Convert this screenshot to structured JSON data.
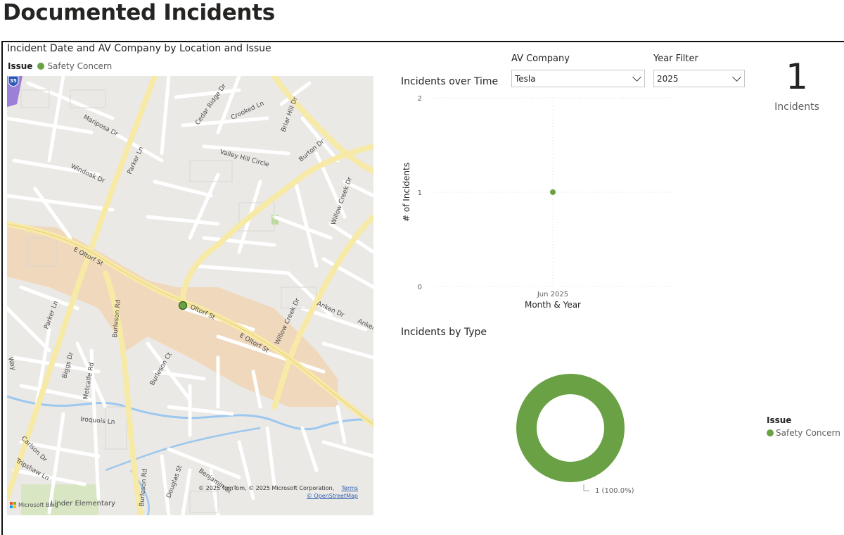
{
  "page": {
    "title": "Documented Incidents"
  },
  "map": {
    "title": "Incident Date and AV Company by Location and Issue",
    "legend_title": "Issue",
    "legend_item": "Safety Concern",
    "legend_color": "#6aa145",
    "highway_shield": "35",
    "streets": {
      "mariposa": "Mariposa Dr",
      "parker_ln_n": "Parker Ln",
      "cedar_ridge": "Cedar Ridge Dr",
      "crooked": "Crooked Ln",
      "briar_hill": "Briar Hill Dr",
      "valley_hill": "Valley Hill Circle",
      "windoak": "Windoak Dr",
      "burton": "Burton Dr",
      "willow_creek_n": "Willow Creek Dr",
      "e_oltorf_w": "E Oltorf St",
      "oltorf_mid": "Oltorf St",
      "e_oltorf_e": "E Oltorf St",
      "willow_creek_s": "Willow Creek Dr",
      "anken": "Anken Dr",
      "anken_e": "Anker",
      "parker_ln_s": "Parker Ln",
      "burleson_n": "Burleson Rd",
      "burleson_ct": "Burleson Ct",
      "way": "Way",
      "biggs": "Biggs Dr",
      "metcalfe": "Metcalfe Rd",
      "iroquois": "Iroquois Ln",
      "carlson": "Carlson Dr",
      "tripshaw": "Tripshaw Ln",
      "burleson_s": "Burleson Rd",
      "douglas": "Douglas St",
      "benjamin": "Benjamin St",
      "linder": "Linder Elementary"
    },
    "attribution": "© 2025 TomTom, © 2025 Microsoft Corporation,",
    "terms": "Terms",
    "osm": "© OpenStreetMap",
    "bing": "Microsoft Bing"
  },
  "slicers": {
    "company": {
      "label": "AV Company",
      "value": "Tesla"
    },
    "year": {
      "label": "Year Filter",
      "value": "2025"
    }
  },
  "kpi": {
    "value": "1",
    "label": "Incidents"
  },
  "chart_data": [
    {
      "type": "line",
      "title": "Incidents over Time",
      "xlabel": "Month & Year",
      "ylabel": "# of Incidents",
      "categories": [
        "Jun 2025"
      ],
      "series": [
        {
          "values": [
            1
          ]
        }
      ],
      "ylim": [
        0,
        2
      ],
      "yticks": [
        "0",
        "1",
        "2"
      ],
      "marker_color": "#6aa145",
      "grid": true
    },
    {
      "type": "pie",
      "title": "Incidents by Type",
      "donut": true,
      "legend_title": "Issue",
      "labels": [
        "Safety Concern"
      ],
      "values": [
        1
      ],
      "data_label": "1 (100.0%)",
      "colors": [
        "#6aa145"
      ],
      "legend_position": "right"
    }
  ]
}
